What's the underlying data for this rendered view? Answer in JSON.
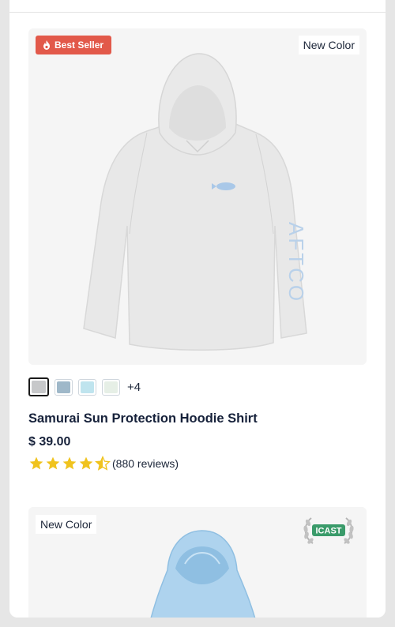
{
  "product": {
    "badges": {
      "best_seller": "Best Seller",
      "new_color": "New Color"
    },
    "image_icon": "hoodie-shirt-white",
    "logo_text": "AFTCO",
    "swatches": [
      {
        "name": "gray",
        "color": "#c7c8ca",
        "selected": true
      },
      {
        "name": "steel-blue",
        "color": "#9fb8c9",
        "selected": false
      },
      {
        "name": "light-blue",
        "color": "#bfe4ee",
        "selected": false
      },
      {
        "name": "mint-white",
        "color": "#e6efe6",
        "selected": false
      }
    ],
    "more_colors": "+4",
    "title": "Samurai Sun Protection Hoodie Shirt",
    "price": "$ 39.00",
    "rating": 4.5,
    "reviews": "(880 reviews)",
    "colors": {
      "star": "#f0c31e",
      "best_seller_bg": "#e2594a"
    }
  },
  "next_product": {
    "badge": "New Color",
    "award_icon": "icast-award-laurel",
    "award_text": "ICAST",
    "image_icon": "hoodie-light-blue"
  }
}
